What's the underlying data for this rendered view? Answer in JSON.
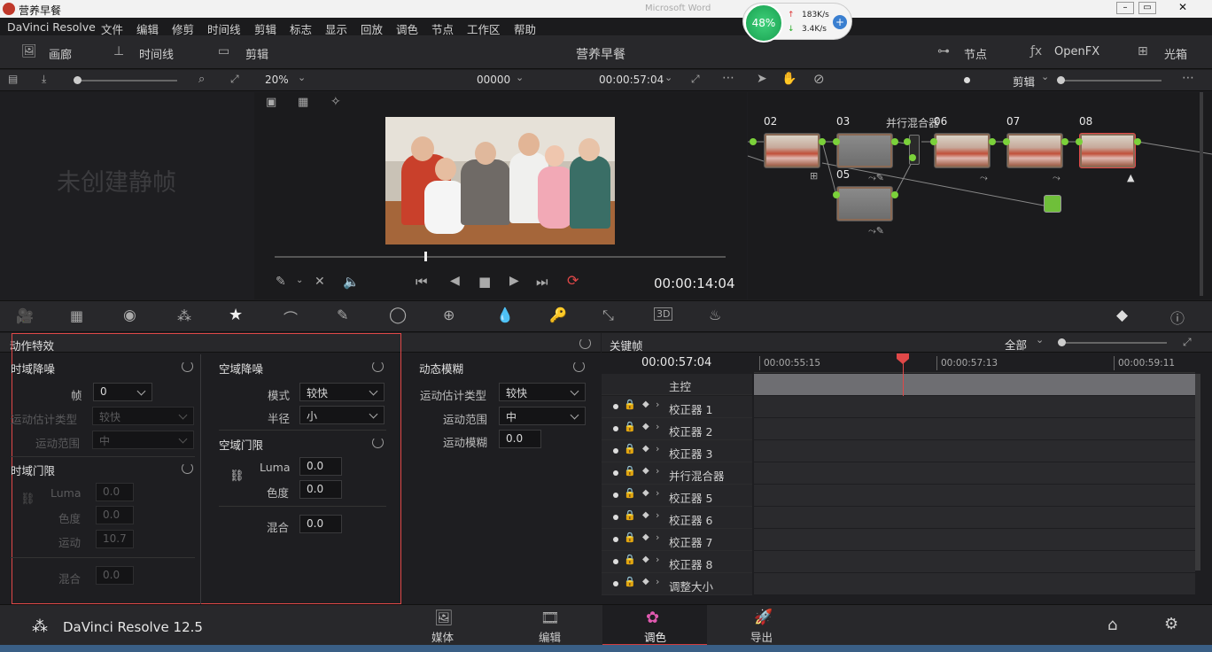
{
  "window": {
    "title": "营养早餐",
    "overlay_text": "Microsoft Word"
  },
  "net_widget": {
    "percent": "48%",
    "up": "183K/s",
    "down": "3.4K/s"
  },
  "menu": [
    "DaVinci Resolve",
    "文件",
    "编辑",
    "修剪",
    "时间线",
    "剪辑",
    "标志",
    "显示",
    "回放",
    "调色",
    "节点",
    "工作区",
    "帮助"
  ],
  "topbar": {
    "gallery": "画廊",
    "timeline": "时间线",
    "clips": "剪辑",
    "project": "营养早餐",
    "nodes": "节点",
    "openfx": "OpenFX",
    "lightbox": "光箱"
  },
  "viewer": {
    "zoom": "20%",
    "timecode_in": "00000",
    "timecode_out": "00:00:57:04",
    "current_time": "00:00:14:04"
  },
  "node_mode": "剪辑",
  "gallery_empty": "未创建静帧",
  "nodes": {
    "n02": "02",
    "n03": "03",
    "n05": "05",
    "n06": "06",
    "n07": "07",
    "n08": "08",
    "parallel_label": "并行混合器"
  },
  "fx": {
    "panel_title": "动作特效",
    "temporal_nr": {
      "title": "时域降噪",
      "frames_label": "帧",
      "frames": "0",
      "motion_type_label": "运动估计类型",
      "motion_type": "较快",
      "motion_range_label": "运动范围",
      "motion_range": "中"
    },
    "temporal_thresh": {
      "title": "时域门限",
      "luma_label": "Luma",
      "luma": "0.0",
      "chroma_label": "色度",
      "chroma": "0.0",
      "motion_label": "运动",
      "motion": "10.7",
      "blend_label": "混合",
      "blend": "0.0"
    },
    "spatial_nr": {
      "title": "空域降噪",
      "mode_label": "模式",
      "mode": "较快",
      "radius_label": "半径",
      "radius": "小"
    },
    "spatial_thresh": {
      "title": "空域门限",
      "luma_label": "Luma",
      "luma": "0.0",
      "chroma_label": "色度",
      "chroma": "0.0",
      "blend_label": "混合",
      "blend": "0.0"
    },
    "motion_blur": {
      "title": "动态模糊",
      "motion_type_label": "运动估计类型",
      "motion_type": "较快",
      "motion_range_label": "运动范围",
      "motion_range": "中",
      "blur_label": "运动模糊",
      "blur": "0.0"
    }
  },
  "keyframes": {
    "title": "关键帧",
    "filter": "全部",
    "timecode": "00:00:57:04",
    "ruler": [
      "00:00:55:15",
      "00:00:57:13",
      "00:00:59:11"
    ],
    "master": "主控",
    "tracks": [
      "校正器 1",
      "校正器 2",
      "校正器 3",
      "并行混合器",
      "校正器 5",
      "校正器 6",
      "校正器 7",
      "校正器 8",
      "调整大小"
    ]
  },
  "footer": {
    "brand": "DaVinci Resolve 12.5",
    "tabs": [
      "媒体",
      "编辑",
      "调色",
      "导出"
    ]
  },
  "colors": {
    "accent_red": "#e04848",
    "node_green": "#7bd13a",
    "active_tab": "#d33c3c"
  }
}
